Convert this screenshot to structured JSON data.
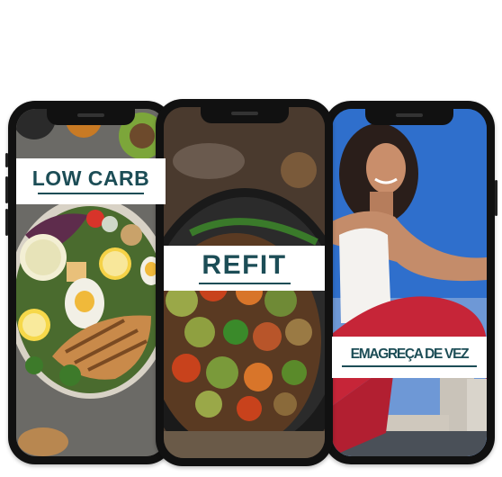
{
  "phones": [
    {
      "label": "LOW CARB"
    },
    {
      "label": "REFIT"
    },
    {
      "label": "EMAGREÇA DE VEZ"
    }
  ],
  "colors": {
    "banner_text": "#1c4d56",
    "banner_bg": "#ffffff",
    "phone_frame": "#111111"
  }
}
